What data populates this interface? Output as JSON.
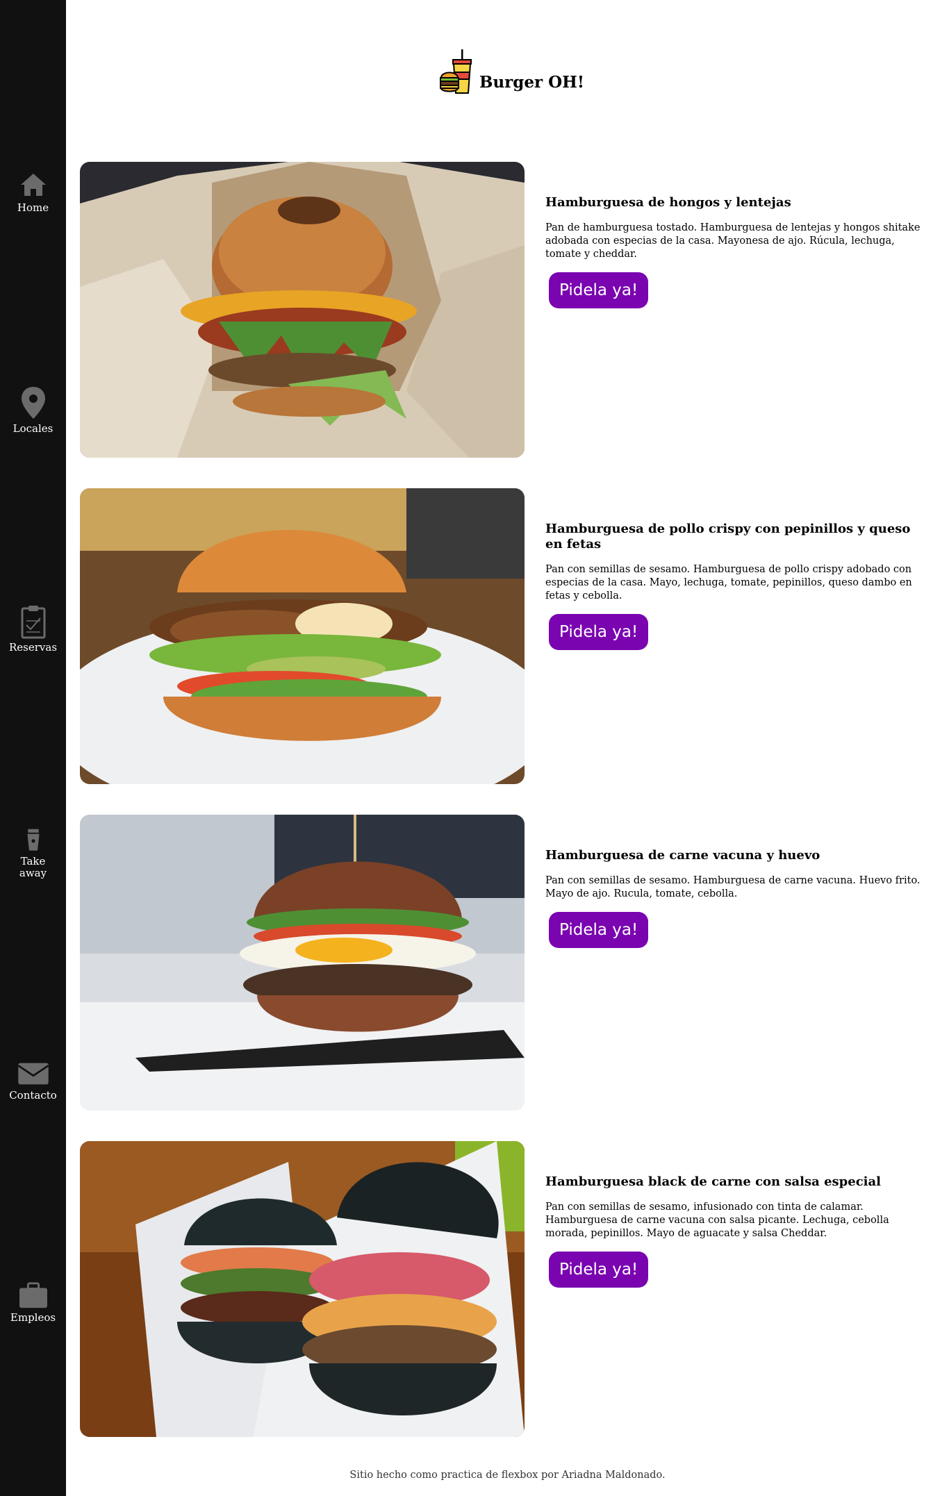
{
  "brand": {
    "title": "Burger OH!",
    "icon": "burger-soda-logo-icon"
  },
  "sidebar": {
    "items": [
      {
        "label": "Home",
        "icon": "home-icon"
      },
      {
        "label": "Locales",
        "icon": "map-pin-icon"
      },
      {
        "label": "Reservas",
        "icon": "clipboard-check-icon"
      },
      {
        "label": "Take away",
        "icon": "coffee-cup-icon"
      },
      {
        "label": "Contacto",
        "icon": "envelope-icon"
      },
      {
        "label": "Empleos",
        "icon": "briefcase-icon"
      }
    ]
  },
  "menu": [
    {
      "title": "Hamburguesa de hongos y lentejas",
      "description": "Pan de hamburguesa tostado. Hamburguesa de lentejas y hongos shitake adobada con especias de la casa. Mayonesa de ajo. Rúcula, lechuga, tomate y cheddar.",
      "button": "Pidela ya!"
    },
    {
      "title": "Hamburguesa de pollo crispy con pepinillos y queso en fetas",
      "description": "Pan con semillas de sesamo. Hamburguesa de pollo crispy adobado con especias de la casa. Mayo, lechuga, tomate, pepinillos, queso dambo en fetas y cebolla.",
      "button": "Pidela ya!"
    },
    {
      "title": "Hamburguesa de carne vacuna y huevo",
      "description": "Pan con semillas de sesamo. Hamburguesa de carne vacuna. Huevo frito. Mayo de ajo. Rucula, tomate, cebolla.",
      "button": "Pidela ya!"
    },
    {
      "title": "Hamburguesa black de carne con salsa especial",
      "description": "Pan con semillas de sesamo, infusionado con tinta de calamar. Hamburguesa de carne vacuna con salsa picante. Lechuga, cebolla morada, pepinillos. Mayo de aguacate y salsa Cheddar.",
      "button": "Pidela ya!"
    }
  ],
  "footer": {
    "text": "Sitio hecho como practica de flexbox por Ariadna Maldonado."
  },
  "colors": {
    "sidebar": "#111111",
    "button": "#7a04b0",
    "background": "#ffffff"
  }
}
